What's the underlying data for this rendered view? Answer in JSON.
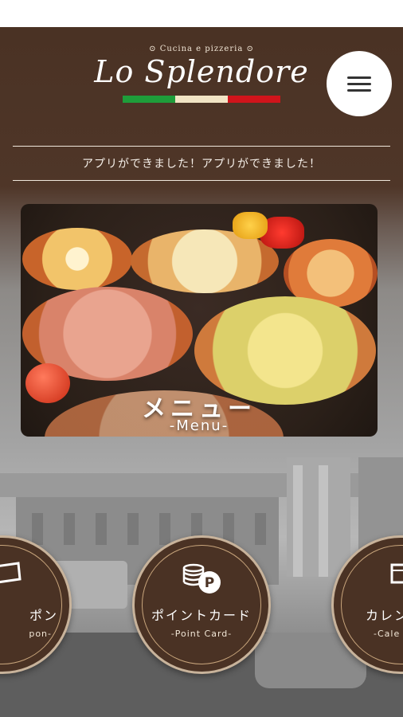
{
  "header": {
    "logo_small": "⊙ Cucina e pizzeria ⊙",
    "logo_main": "Lo Splendore",
    "flag_colors": [
      "#1e9d3a",
      "#f1e4c4",
      "#d0141b"
    ]
  },
  "ticker": {
    "text": "アプリができました！アプリができました！"
  },
  "menu_banner": {
    "title": "メニュー",
    "subtitle": "-Menu-"
  },
  "nav_buttons": [
    {
      "label": "ポン",
      "sub": "pon-",
      "icon": "coupon-icon"
    },
    {
      "label": "ポイントカード",
      "sub": "-Point Card-",
      "icon": "point-card-icon"
    },
    {
      "label": "カレン",
      "sub": "-Cale",
      "icon": "calendar-icon"
    }
  ],
  "colors": {
    "brand_brown": "#4a3224",
    "ring": "#c8b39b",
    "white": "#ffffff"
  }
}
